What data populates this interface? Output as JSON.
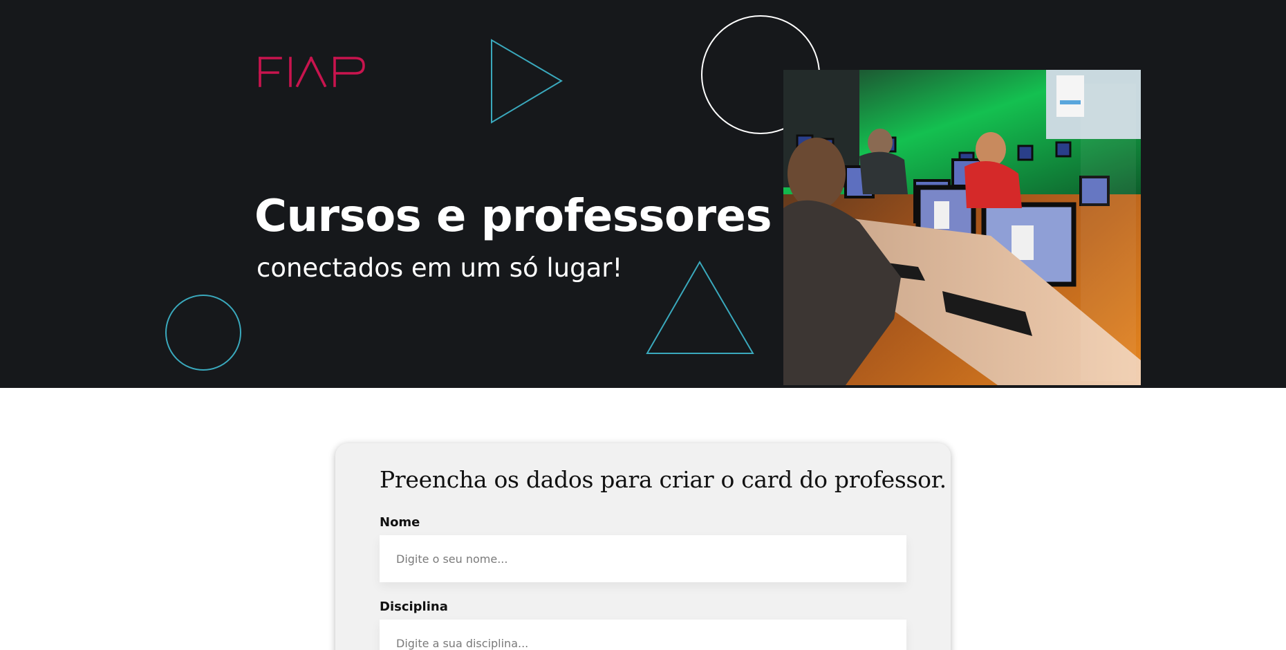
{
  "brand": {
    "logo_text": "FIAP",
    "logo_color": "#c8144e"
  },
  "hero": {
    "title": "Cursos e professores",
    "subtitle": "conectados em um só lugar!",
    "background": "#16181b",
    "accent_teal": "#3aa9bd"
  },
  "form": {
    "heading": "Preencha os dados para criar o card do professor.",
    "fields": [
      {
        "label": "Nome",
        "placeholder": "Digite o seu nome..."
      },
      {
        "label": "Disciplina",
        "placeholder": "Digite a sua disciplina..."
      }
    ]
  }
}
